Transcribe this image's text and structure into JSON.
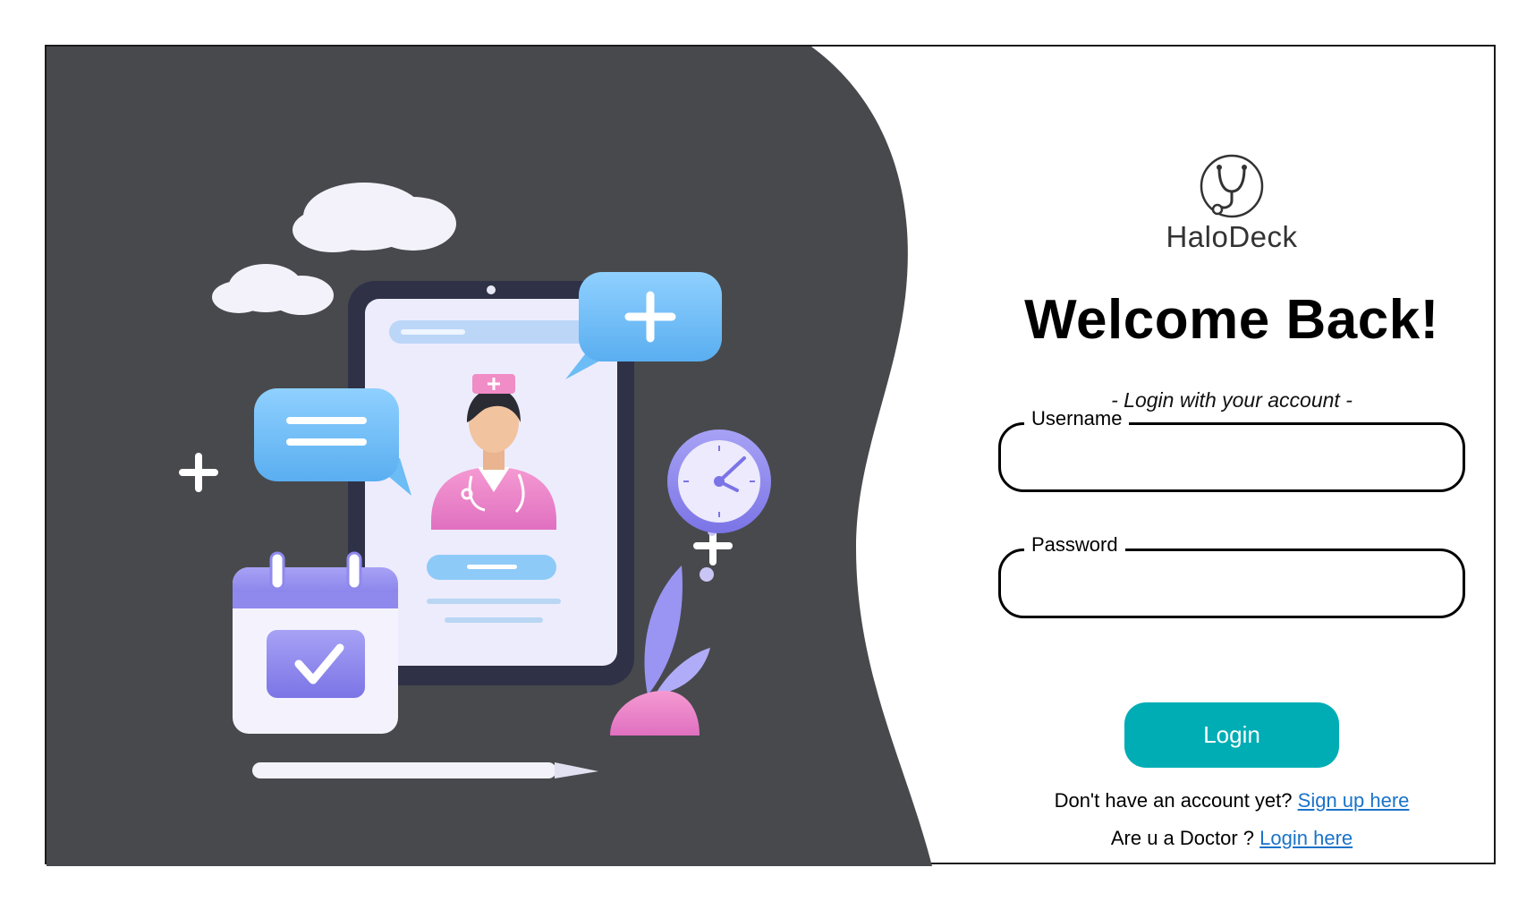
{
  "brand": {
    "name": "HaloDeck",
    "icon": "stethoscope-icon"
  },
  "heading": {
    "title": "Welcome Back!",
    "subtitle": "- Login with your account -"
  },
  "form": {
    "username": {
      "label": "Username",
      "value": ""
    },
    "password": {
      "label": "Password",
      "value": ""
    },
    "login_label": "Login"
  },
  "links": {
    "signup_prompt": "Don't  have an account yet?",
    "signup_link": "Sign up here",
    "doctor_prompt": "Are u a Doctor ?",
    "doctor_link": "Login here"
  },
  "colors": {
    "accent": "#00adb5",
    "panel_bg": "#48494d",
    "link": "#1a73c9"
  },
  "illustration": {
    "name": "telemedicine-illustration",
    "icons": [
      "tablet-icon",
      "nurse-icon",
      "chat-bubble-icon",
      "plus-icon",
      "clock-icon",
      "calendar-check-icon",
      "cloud-icon",
      "leaf-icon",
      "pencil-icon"
    ]
  }
}
